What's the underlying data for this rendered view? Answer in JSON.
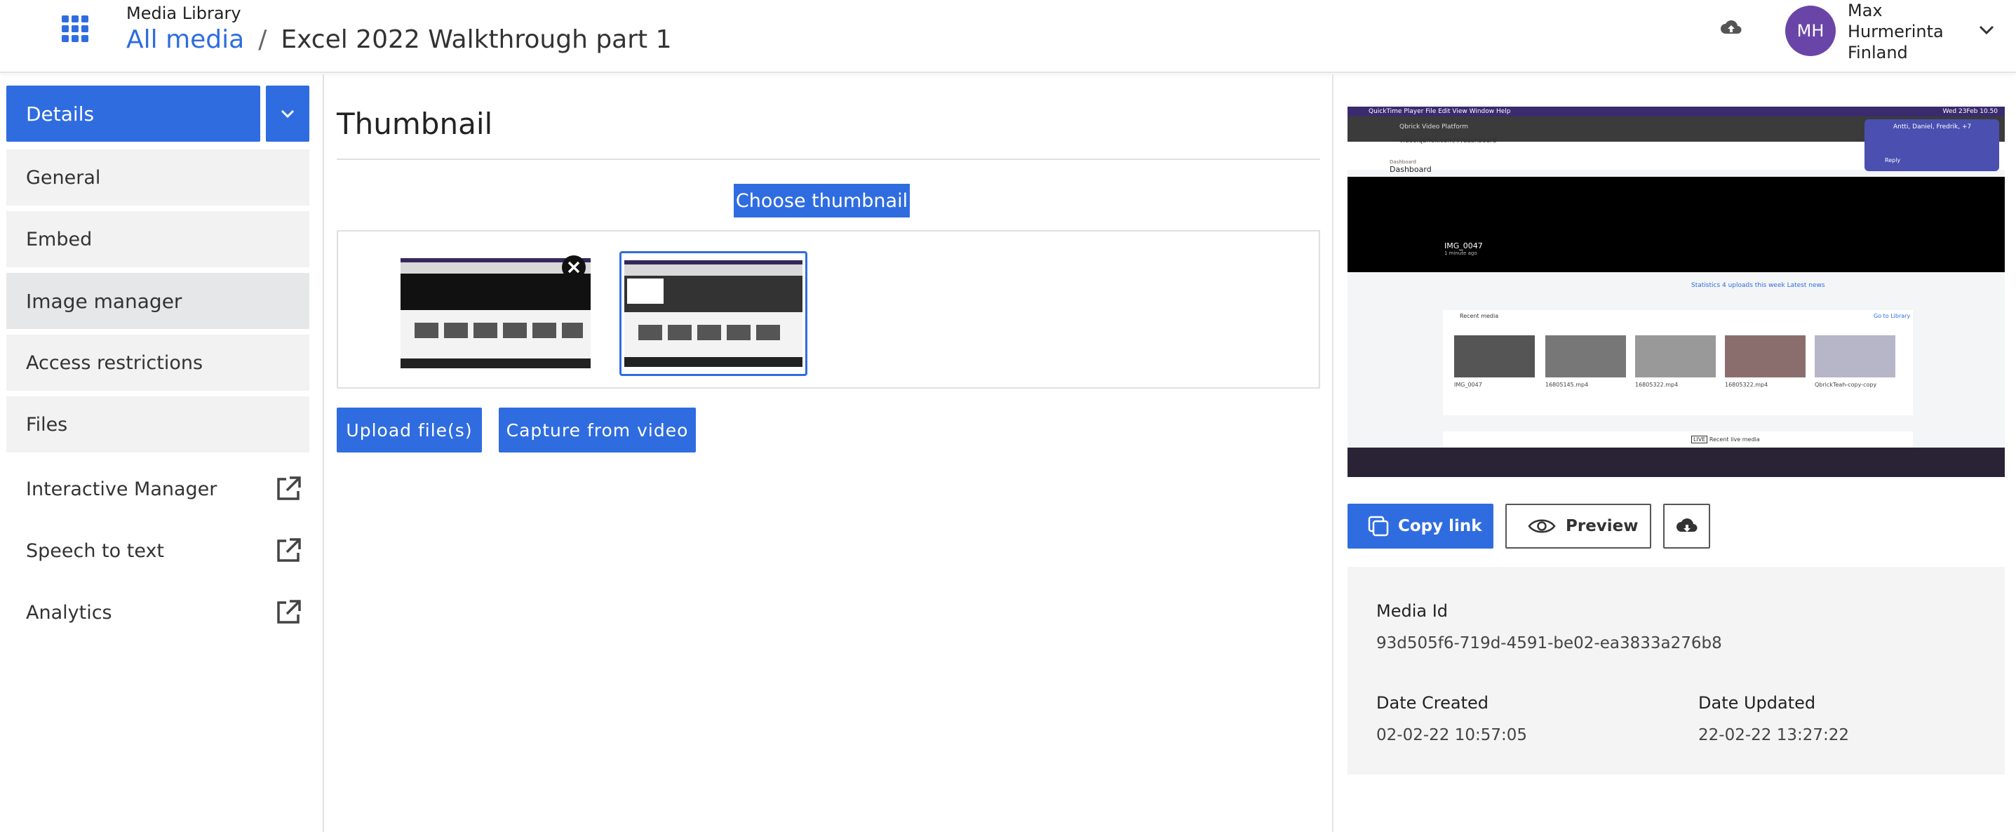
{
  "header": {
    "subtitle": "Media Library",
    "breadcrumb_link": "All media",
    "breadcrumb_sep": "/",
    "breadcrumb_current": "Excel 2022 Walkthrough part 1",
    "user": {
      "initials": "MH",
      "first_name": "Max",
      "last_name": "Hurmerinta",
      "country": "Finland",
      "avatar_color": "#6a45a8"
    }
  },
  "sidebar": {
    "details_label": "Details",
    "items": [
      {
        "label": "General"
      },
      {
        "label": "Embed"
      },
      {
        "label": "Image manager",
        "active": true
      },
      {
        "label": "Access restrictions"
      },
      {
        "label": "Files"
      }
    ],
    "external_items": [
      {
        "label": "Interactive Manager"
      },
      {
        "label": "Speech to text"
      },
      {
        "label": "Analytics"
      }
    ]
  },
  "main": {
    "title": "Thumbnail",
    "choose_label": "Choose thumbnail",
    "upload_label": "Upload file(s)",
    "capture_label": "Capture from video"
  },
  "preview": {
    "menubar_text": "QuickTime Player   File   Edit   View   Window   Help",
    "menubar_clock": "Wed 23Feb 10.50",
    "url_text": "video.qbrick.com/#/dashboard",
    "tab_title": "Qbrick Video Platform",
    "dashboard_crumb": "Dashboard",
    "dashboard_title": "Dashboard",
    "notification_title": "Antti, Daniel, Fredrik, +7",
    "notification_reply": "Reply",
    "video_title": "IMG_0047",
    "video_subtitle": "1 minute ago",
    "tags": "Statistics    4 uploads this week    Latest news",
    "recent_title": "Recent media",
    "recent_link": "Go to Library",
    "cards": [
      {
        "label": "IMG_0047"
      },
      {
        "label": "16805145.mp4"
      },
      {
        "label": "16805322.mp4"
      },
      {
        "label": "16805322.mp4"
      },
      {
        "label": "QbrickTeah-copy-copy"
      }
    ],
    "live_label": "LIVE",
    "live_title": "Recent live media"
  },
  "actions": {
    "copy_label": "Copy link",
    "preview_label": "Preview"
  },
  "info": {
    "media_id_label": "Media Id",
    "media_id_value": "93d505f6-719d-4591-be02-ea3833a276b8",
    "created_label": "Date Created",
    "created_value": "02-02-22 10:57:05",
    "updated_label": "Date Updated",
    "updated_value": "22-02-22 13:27:22"
  },
  "colors": {
    "accent": "#2f6ce0",
    "sidebar_bg": "#f2f2f2",
    "active_bg": "#e6e7e8"
  },
  "icons": [
    "apps-grid-icon",
    "cloud-upload-icon",
    "chevron-down-icon",
    "external-link-icon",
    "close-icon",
    "copy-icon",
    "eye-icon",
    "download-icon"
  ]
}
